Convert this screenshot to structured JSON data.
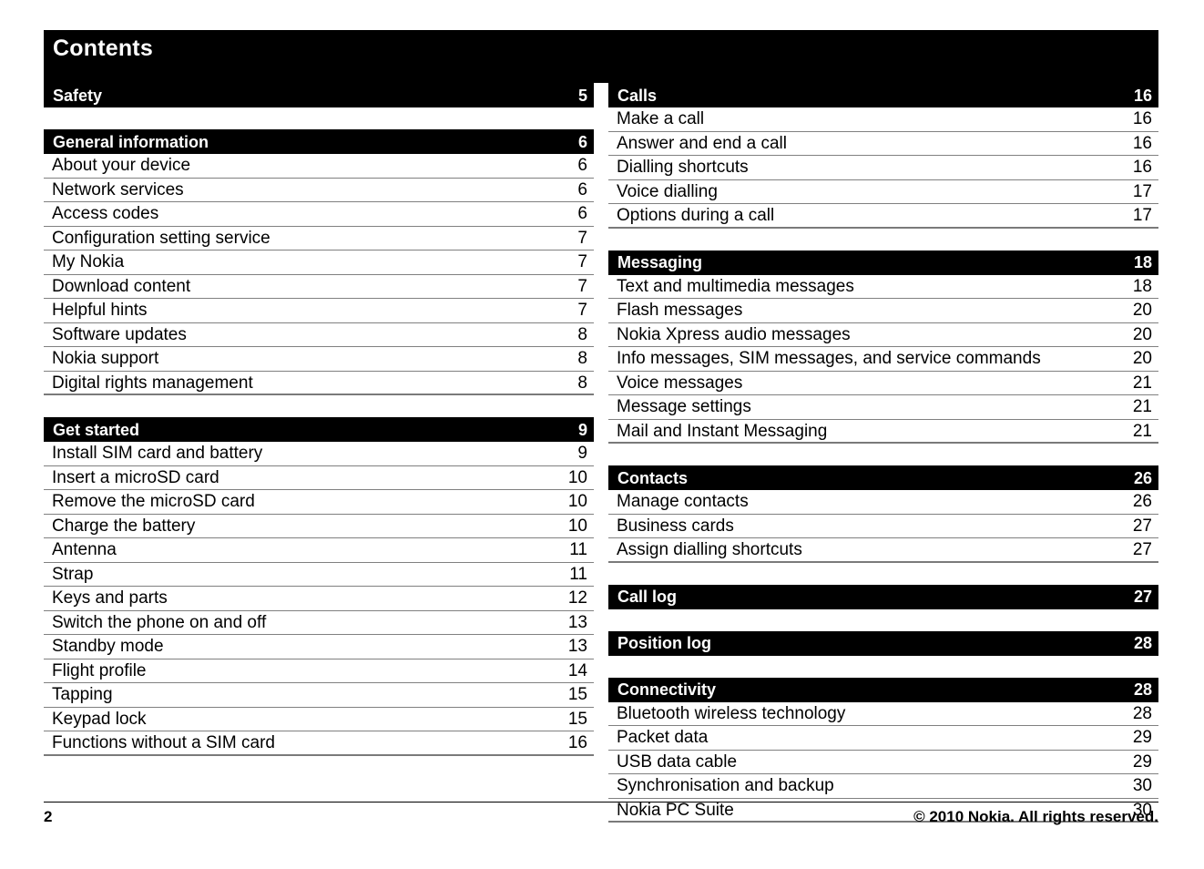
{
  "document": {
    "title": "Contents"
  },
  "left_column": {
    "groups": [
      {
        "header": {
          "label": "Safety",
          "page": "5"
        },
        "entries": []
      },
      {
        "header": {
          "label": "General information",
          "page": "6"
        },
        "entries": [
          {
            "label": "About your device",
            "page": "6"
          },
          {
            "label": "Network services",
            "page": "6"
          },
          {
            "label": "Access codes",
            "page": "6"
          },
          {
            "label": "Configuration setting service",
            "page": "7"
          },
          {
            "label": "My Nokia",
            "page": "7"
          },
          {
            "label": "Download content",
            "page": "7"
          },
          {
            "label": "Helpful hints",
            "page": "7"
          },
          {
            "label": "Software updates",
            "page": "8"
          },
          {
            "label": "Nokia support",
            "page": "8"
          },
          {
            "label": "Digital rights management",
            "page": "8"
          }
        ]
      },
      {
        "header": {
          "label": "Get started",
          "page": "9"
        },
        "entries": [
          {
            "label": "Install SIM card and battery",
            "page": "9"
          },
          {
            "label": "Insert a microSD card",
            "page": "10"
          },
          {
            "label": "Remove the microSD card",
            "page": "10"
          },
          {
            "label": "Charge the battery",
            "page": "10"
          },
          {
            "label": "Antenna",
            "page": "11"
          },
          {
            "label": "Strap",
            "page": "11"
          },
          {
            "label": "Keys and parts",
            "page": "12"
          },
          {
            "label": "Switch the phone on and off",
            "page": "13"
          },
          {
            "label": "Standby mode",
            "page": "13"
          },
          {
            "label": "Flight profile",
            "page": "14"
          },
          {
            "label": "Tapping",
            "page": "15"
          },
          {
            "label": "Keypad lock",
            "page": "15"
          },
          {
            "label": "Functions without a SIM card",
            "page": "16"
          }
        ]
      }
    ]
  },
  "right_column": {
    "groups": [
      {
        "header": {
          "label": "Calls",
          "page": "16"
        },
        "entries": [
          {
            "label": "Make a call",
            "page": "16"
          },
          {
            "label": "Answer and end a call",
            "page": "16"
          },
          {
            "label": "Dialling shortcuts",
            "page": "16"
          },
          {
            "label": "Voice dialling",
            "page": "17"
          },
          {
            "label": "Options during a call",
            "page": "17"
          }
        ]
      },
      {
        "header": {
          "label": "Messaging",
          "page": "18"
        },
        "entries": [
          {
            "label": "Text and multimedia messages",
            "page": "18"
          },
          {
            "label": "Flash messages",
            "page": "20"
          },
          {
            "label": "Nokia Xpress audio messages",
            "page": "20"
          },
          {
            "label": "Info messages, SIM messages, and service commands",
            "page": "20"
          },
          {
            "label": "Voice messages",
            "page": "21"
          },
          {
            "label": "Message settings",
            "page": "21"
          },
          {
            "label": "Mail and Instant Messaging",
            "page": "21"
          }
        ]
      },
      {
        "header": {
          "label": "Contacts",
          "page": "26"
        },
        "entries": [
          {
            "label": "Manage contacts",
            "page": "26"
          },
          {
            "label": "Business cards",
            "page": "27"
          },
          {
            "label": "Assign dialling shortcuts",
            "page": "27"
          }
        ]
      },
      {
        "header": {
          "label": "Call log",
          "page": "27"
        },
        "entries": []
      },
      {
        "header": {
          "label": "Position log",
          "page": "28"
        },
        "entries": []
      },
      {
        "header": {
          "label": "Connectivity",
          "page": "28"
        },
        "entries": [
          {
            "label": "Bluetooth wireless technology",
            "page": "28"
          },
          {
            "label": "Packet data",
            "page": "29"
          },
          {
            "label": "USB data cable",
            "page": "29"
          },
          {
            "label": "Synchronisation and backup",
            "page": "30"
          },
          {
            "label": "Nokia PC Suite",
            "page": "30"
          }
        ]
      }
    ]
  },
  "footer": {
    "page_number": "2",
    "copyright": "© 2010 Nokia. All rights reserved."
  }
}
